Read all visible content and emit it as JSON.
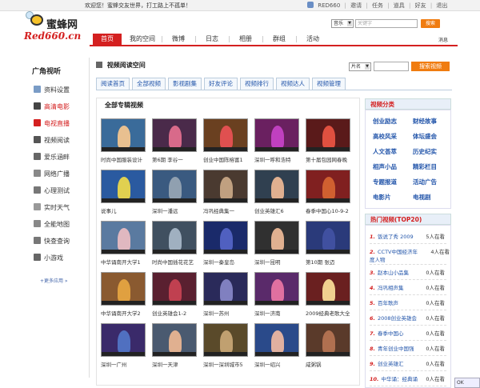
{
  "topbar": {
    "welcome": "欢迎您！蜜蜂交友世界，打工路上不孤单！",
    "links": [
      "RED660",
      "|",
      "邀请",
      "|",
      "任务",
      "|",
      "道具",
      "|",
      "好友",
      "|",
      "退出"
    ]
  },
  "logo": {
    "cn": "蜜蜂网",
    "en": "Red660.cn"
  },
  "search": {
    "select": "音乐",
    "placeholder": "关键字",
    "button": "搜索"
  },
  "nav": {
    "tabs": [
      "首页",
      "我的空间",
      "微博",
      "日志",
      "相册",
      "群组",
      "活动"
    ],
    "active": 0,
    "news": "消息"
  },
  "sidebar": {
    "title": "广角视听",
    "items": [
      {
        "label": "资料设置",
        "icon": "settings-icon",
        "color": "#7a9cc6"
      },
      {
        "label": "高清电影",
        "icon": "film-icon",
        "color": "#444",
        "red": true
      },
      {
        "label": "电视直播",
        "icon": "tv-icon",
        "color": "#d42020",
        "red": true
      },
      {
        "label": "视频阅读",
        "icon": "video-icon",
        "color": "#555"
      },
      {
        "label": "爱乐涵畔",
        "icon": "music-icon",
        "color": "#666"
      },
      {
        "label": "网络广播",
        "icon": "radio-icon",
        "color": "#888"
      },
      {
        "label": "心理测试",
        "icon": "chart-icon",
        "color": "#777"
      },
      {
        "label": "实时天气",
        "icon": "weather-icon",
        "color": "#999"
      },
      {
        "label": "全能地图",
        "icon": "map-icon",
        "color": "#888"
      },
      {
        "label": "快查查询",
        "icon": "query-icon",
        "color": "#777"
      },
      {
        "label": "小游戏",
        "icon": "game-icon",
        "color": "#666"
      }
    ],
    "more": "+更多应用 »"
  },
  "panel": {
    "title": "视频阅读空间",
    "film_select": "片名",
    "search_button": "搜索视频",
    "subtabs": [
      "阅读首页",
      "全部视频",
      "影视剧集",
      "好友评论",
      "视频排行",
      "视频达人",
      "视频管理"
    ],
    "grid_title": "全部专辑视频"
  },
  "videos": [
    {
      "title": "时尚中国服装设计",
      "bg": "#3a6b9a",
      "fig": "#e8c090"
    },
    {
      "title": "第6期 李谷一",
      "bg": "#4a2a4a",
      "fig": "#d86a8a"
    },
    {
      "title": "创业中国陈榕富1",
      "bg": "#6a4020",
      "fig": "#e05050"
    },
    {
      "title": "深圳一呼和浩特",
      "bg": "#6a2060",
      "fig": "#c040c0"
    },
    {
      "title": "第十届包园网春晚",
      "bg": "#5a1a1a",
      "fig": "#e05040"
    },
    {
      "title": "说事儿",
      "bg": "#2a5aa0",
      "fig": "#e0d050"
    },
    {
      "title": "深圳一潘远",
      "bg": "#3a5a80",
      "fig": "#90a0b0"
    },
    {
      "title": "冯巩经典集一",
      "bg": "#4a3a30",
      "fig": "#c0a080"
    },
    {
      "title": "创业英雄汇6",
      "bg": "#304050",
      "fig": "#e0b090"
    },
    {
      "title": "春季中国心10-9-2",
      "bg": "#802020",
      "fig": "#d06030"
    },
    {
      "title": "中华诵南开大学1",
      "bg": "#5a7aa0",
      "fig": "#e0b8c0"
    },
    {
      "title": "时尚中国插花花艺",
      "bg": "#405060",
      "fig": "#a0b0c0"
    },
    {
      "title": "深圳一秦皇岛",
      "bg": "#1a2a6a",
      "fig": "#5060c0"
    },
    {
      "title": "深圳一昆明",
      "bg": "#303030",
      "fig": "#e0b090"
    },
    {
      "title": "第10期 张迈",
      "bg": "#2a3a7a",
      "fig": "#4050a0"
    },
    {
      "title": "中华诵南开大学2",
      "bg": "#8a5a30",
      "fig": "#e0a040"
    },
    {
      "title": "创业英雄会1-2",
      "bg": "#5a2030",
      "fig": "#c04050"
    },
    {
      "title": "深圳一苏州",
      "bg": "#2a2a5a",
      "fig": "#8080c0"
    },
    {
      "title": "深圳一济南",
      "bg": "#5a2a6a",
      "fig": "#e070a0"
    },
    {
      "title": "2009经典老歌大全",
      "bg": "#6a2020",
      "fig": "#f0d090"
    },
    {
      "title": "深圳一广州",
      "bg": "#3a2a6a",
      "fig": "#5070c0"
    },
    {
      "title": "深圳一天津",
      "bg": "#4a5a70",
      "fig": "#e0b090"
    },
    {
      "title": "深圳一深圳城市5",
      "bg": "#5a4a2a",
      "fig": "#c0a070"
    },
    {
      "title": "深圳一绍兴",
      "bg": "#2a4a8a",
      "fig": "#e0b0a0"
    },
    {
      "title": "咸粥锅",
      "bg": "#5a3a2a",
      "fig": "#b07050"
    }
  ],
  "categories": {
    "title": "视频分类",
    "items": [
      "创业励志",
      "财经故事",
      "高校风采",
      "体坛盛会",
      "人文荟萃",
      "历史纪实",
      "相声小品",
      "精彩栏目",
      "专题报道",
      "活动广告",
      "电影片",
      "电视剧"
    ]
  },
  "hot": {
    "title": "热门视频(TOP20)",
    "items": [
      {
        "num": "1.",
        "title": "饭说了秀 2009",
        "count": "5人在看"
      },
      {
        "num": "2.",
        "title": "CCTV中国经济年度人物",
        "count": "4人在看"
      },
      {
        "num": "3.",
        "title": "赵本山小品集",
        "count": "0人在看"
      },
      {
        "num": "4.",
        "title": "冯巩相声集",
        "count": "0人在看"
      },
      {
        "num": "5.",
        "title": "百年歌声",
        "count": "0人在看"
      },
      {
        "num": "6.",
        "title": "2008创业英雄会",
        "count": "0人在看"
      },
      {
        "num": "7.",
        "title": "春季中国心",
        "count": "0人在看"
      },
      {
        "num": "8.",
        "title": "青年创业中国强",
        "count": "0人在看"
      },
      {
        "num": "9.",
        "title": "创业英雄汇",
        "count": "0人在看"
      },
      {
        "num": "10.",
        "title": "中华诵：经典诵",
        "count": "0人在看"
      }
    ]
  },
  "corner_badge": "OK"
}
